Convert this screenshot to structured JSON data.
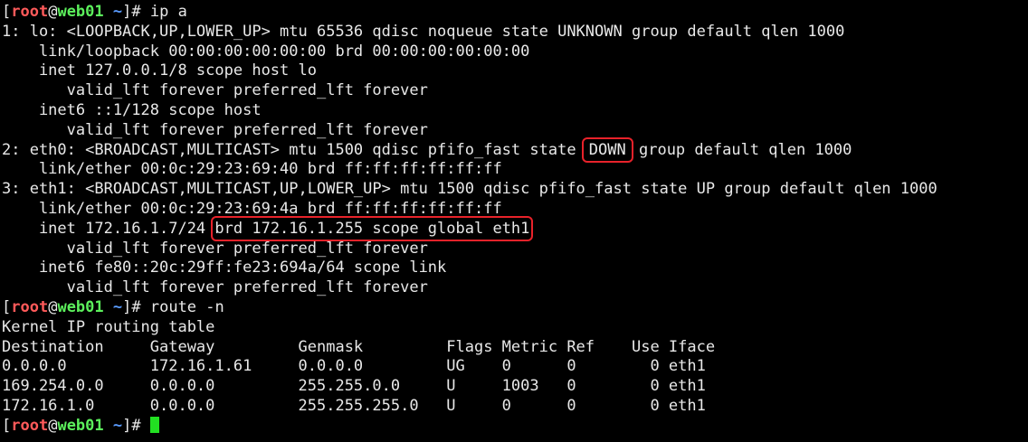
{
  "prompt": {
    "open": "[",
    "user": "root",
    "at": "@",
    "host": "web01",
    "dir": "~",
    "close": "]# "
  },
  "commands": {
    "first": "ip a",
    "second": "route -n",
    "third": ""
  },
  "ip_output": {
    "lines": [
      "1: lo: <LOOPBACK,UP,LOWER_UP> mtu 65536 qdisc noqueue state UNKNOWN group default qlen 1000",
      "    link/loopback 00:00:00:00:00:00 brd 00:00:00:00:00:00",
      "    inet 127.0.0.1/8 scope host lo",
      "       valid_lft forever preferred_lft forever",
      "    inet6 ::1/128 scope host",
      "       valid_lft forever preferred_lft forever"
    ],
    "eth0_pre": "2: eth0: <BROADCAST,MULTICAST> mtu 1500 qdisc pfifo_fast state ",
    "eth0_state": "DOWN",
    "eth0_post": " group default qlen 1000",
    "eth0_link": "    link/ether 00:0c:29:23:69:40 brd ff:ff:ff:ff:ff:ff",
    "eth1_header": "3: eth1: <BROADCAST,MULTICAST,UP,LOWER_UP> mtu 1500 qdisc pfifo_fast state UP group default qlen 1000",
    "eth1_link": "    link/ether 00:0c:29:23:69:4a brd ff:ff:ff:ff:ff:ff",
    "eth1_inet_pre": "    inet 172.16.1.7/24 ",
    "eth1_inet_highlight": "brd 172.16.1.255 scope global eth1",
    "eth1_tail": [
      "       valid_lft forever preferred_lft forever",
      "    inet6 fe80::20c:29ff:fe23:694a/64 scope link",
      "       valid_lft forever preferred_lft forever"
    ]
  },
  "route_output": {
    "title": "Kernel IP routing table",
    "header": "Destination     Gateway         Genmask         Flags Metric Ref    Use Iface",
    "rows": [
      "0.0.0.0         172.16.1.61     0.0.0.0         UG    0      0        0 eth1",
      "169.254.0.0     0.0.0.0         255.255.0.0     U     1003   0        0 eth1",
      "172.16.1.0      0.0.0.0         255.255.255.0   U     0      0        0 eth1"
    ]
  },
  "colors": {
    "background": "#000000",
    "text": "#e8e8e8",
    "user": "#ff5a5a",
    "host": "#5cf05c",
    "dir": "#5a9cff",
    "cursor": "#22e022",
    "highlight_box": "#e8222a"
  }
}
